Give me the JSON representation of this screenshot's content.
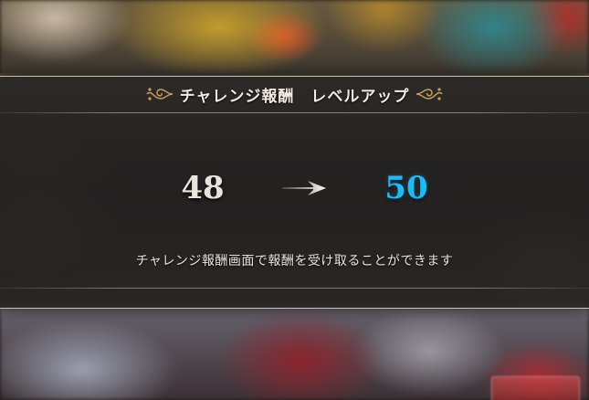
{
  "dialog": {
    "title": "チャレンジ報酬　レベルアップ",
    "level_before": "48",
    "level_after": "50",
    "message": "チャレンジ報酬画面で報酬を受け取ることができます"
  },
  "colors": {
    "title_text": "#f2ece2",
    "level_before": "#e8e4dc",
    "level_after": "#22b8f0",
    "ornament": "#c8a060"
  },
  "icons": {
    "title_left": "ornament-flourish-icon",
    "title_right": "ornament-flourish-icon",
    "level_arrow": "right-arrow-icon"
  }
}
